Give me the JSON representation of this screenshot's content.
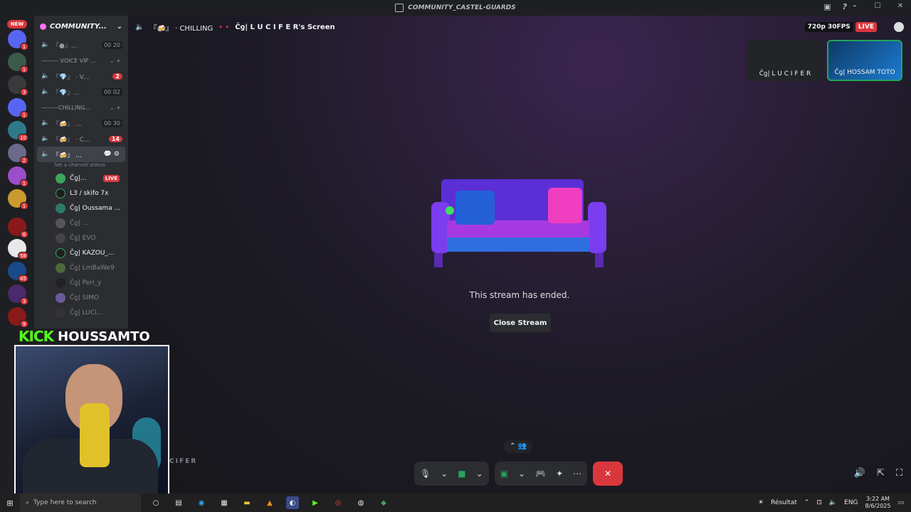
{
  "titlebar": {
    "title": "COMMUNITY_CASTEL-GUARDS"
  },
  "rail": {
    "new_label": "NEW",
    "badges": [
      "1",
      "1",
      "3",
      "1",
      "10",
      "2",
      "1",
      "1",
      "6",
      "58",
      "45",
      "3",
      "9"
    ]
  },
  "sidebar": {
    "server_name": "COMMUNITY...",
    "channels_top": [
      {
        "name": "『●』...",
        "counts": "00 20"
      }
    ],
    "category_voice_vip": "——— VOICE VIP ...",
    "vip_channels": [
      {
        "name": "『💎』 · V...",
        "badge": "2"
      },
      {
        "name": "『💎』...",
        "counts": "00 02"
      }
    ],
    "category_chilling": "———CHILLING...",
    "chill_channels": [
      {
        "name": "『🍻』 ...",
        "counts": "00 30"
      },
      {
        "name": "『🍻』 · C...",
        "badge": "14"
      },
      {
        "name": "『🍻』 ..."
      }
    ],
    "set_status": "Set a channel status",
    "users": [
      {
        "name": "Čƍ|...",
        "live": "LIVE"
      },
      {
        "name": "L3 / skifo 7x"
      },
      {
        "name": "Čƍ| Oussama ..."
      },
      {
        "name": "Čƍ| ..."
      },
      {
        "name": "Čƍ| EVO"
      },
      {
        "name": "Čƍ| KAZOU_..."
      },
      {
        "name": "Čƍ| LmBaWe9"
      },
      {
        "name": "Čƍ| Perl_y"
      },
      {
        "name": "Čƍ| SIMO"
      },
      {
        "name": "Čƍ| LUCI..."
      }
    ]
  },
  "stage": {
    "channel": "『🍻』 · CHILLING",
    "stream_title": "Čƍ| L U C I F E R's Screen",
    "quality": "720p 30FPS",
    "live": "LIVE",
    "tile1": "Čƍ| L U C I F E R",
    "tile2": "Čƍ| HOSSAM TOTO",
    "ended_text": "This stream has ended.",
    "close_button": "Close Stream",
    "watermark": "CIFER"
  },
  "overlay": {
    "kick": "KICK",
    "name": "HOUSSAMTO"
  },
  "taskbar": {
    "search_placeholder": "Type here to search",
    "weather": "Résultat",
    "lang": "ENG",
    "time": "3:22 AM",
    "date": "8/6/2025"
  }
}
